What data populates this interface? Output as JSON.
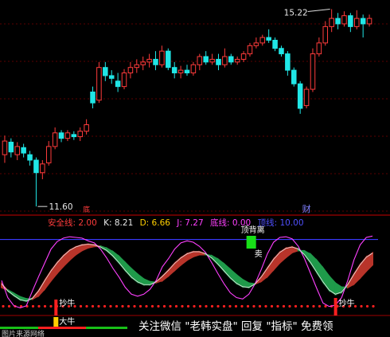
{
  "chart_data": [
    {
      "type": "candlestick",
      "title": "",
      "annotations": {
        "high_label": "15.22",
        "low_label": "11.60",
        "marker_cai": "财",
        "marker_di": "底"
      },
      "colors": {
        "up": "#ff3b3b",
        "down": "#20e6e6",
        "grid": "#7a0000"
      },
      "candles": [
        {
          "o": 12.55,
          "c": 12.8,
          "h": 12.9,
          "l": 12.4
        },
        {
          "o": 12.78,
          "c": 12.6,
          "h": 12.85,
          "l": 12.5
        },
        {
          "o": 12.55,
          "c": 12.7,
          "h": 12.78,
          "l": 12.45
        },
        {
          "o": 12.68,
          "c": 12.58,
          "h": 12.75,
          "l": 12.5
        },
        {
          "o": 12.55,
          "c": 12.45,
          "h": 12.62,
          "l": 12.35
        },
        {
          "o": 12.45,
          "c": 12.22,
          "h": 12.5,
          "l": 11.6
        },
        {
          "o": 12.22,
          "c": 12.38,
          "h": 12.45,
          "l": 12.1
        },
        {
          "o": 12.4,
          "c": 12.7,
          "h": 12.8,
          "l": 12.35
        },
        {
          "o": 12.7,
          "c": 12.95,
          "h": 13.05,
          "l": 12.65
        },
        {
          "o": 12.95,
          "c": 12.85,
          "h": 13.0,
          "l": 12.78
        },
        {
          "o": 12.85,
          "c": 12.95,
          "h": 13.0,
          "l": 12.8
        },
        {
          "o": 12.92,
          "c": 12.88,
          "h": 12.98,
          "l": 12.82
        },
        {
          "o": 12.88,
          "c": 12.98,
          "h": 13.05,
          "l": 12.8
        },
        {
          "o": 12.98,
          "c": 13.1,
          "h": 13.2,
          "l": 12.92
        },
        {
          "o": 13.7,
          "c": 13.5,
          "h": 13.8,
          "l": 13.4
        },
        {
          "o": 13.55,
          "c": 14.15,
          "h": 14.25,
          "l": 13.5
        },
        {
          "o": 14.15,
          "c": 14.0,
          "h": 14.25,
          "l": 13.9
        },
        {
          "o": 14.0,
          "c": 13.95,
          "h": 14.1,
          "l": 13.85
        },
        {
          "o": 13.9,
          "c": 13.8,
          "h": 14.05,
          "l": 13.7
        },
        {
          "o": 13.8,
          "c": 14.05,
          "h": 14.12,
          "l": 13.75
        },
        {
          "o": 14.05,
          "c": 14.15,
          "h": 14.25,
          "l": 13.95
        },
        {
          "o": 14.15,
          "c": 14.2,
          "h": 14.3,
          "l": 14.05
        },
        {
          "o": 14.2,
          "c": 14.25,
          "h": 14.35,
          "l": 14.1
        },
        {
          "o": 14.25,
          "c": 14.3,
          "h": 14.4,
          "l": 14.15
        },
        {
          "o": 14.3,
          "c": 14.2,
          "h": 14.45,
          "l": 14.1
        },
        {
          "o": 14.2,
          "c": 14.45,
          "h": 14.55,
          "l": 14.15
        },
        {
          "o": 14.45,
          "c": 14.15,
          "h": 14.5,
          "l": 14.1
        },
        {
          "o": 14.15,
          "c": 14.05,
          "h": 14.25,
          "l": 13.95
        },
        {
          "o": 14.05,
          "c": 14.1,
          "h": 14.18,
          "l": 13.95
        },
        {
          "o": 14.1,
          "c": 14.05,
          "h": 14.2,
          "l": 14.0
        },
        {
          "o": 14.05,
          "c": 14.2,
          "h": 14.25,
          "l": 14.0
        },
        {
          "o": 14.2,
          "c": 14.35,
          "h": 14.4,
          "l": 14.1
        },
        {
          "o": 14.35,
          "c": 14.25,
          "h": 14.45,
          "l": 14.2
        },
        {
          "o": 14.25,
          "c": 14.3,
          "h": 14.4,
          "l": 14.2
        },
        {
          "o": 14.3,
          "c": 14.2,
          "h": 14.4,
          "l": 14.1
        },
        {
          "o": 14.2,
          "c": 14.35,
          "h": 14.5,
          "l": 14.15
        },
        {
          "o": 14.35,
          "c": 14.25,
          "h": 14.4,
          "l": 14.2
        },
        {
          "o": 14.25,
          "c": 14.3,
          "h": 14.35,
          "l": 14.2
        },
        {
          "o": 14.3,
          "c": 14.4,
          "h": 14.45,
          "l": 14.25
        },
        {
          "o": 14.4,
          "c": 14.55,
          "h": 14.6,
          "l": 14.35
        },
        {
          "o": 14.55,
          "c": 14.6,
          "h": 14.7,
          "l": 14.5
        },
        {
          "o": 14.6,
          "c": 14.7,
          "h": 14.75,
          "l": 14.55
        },
        {
          "o": 14.7,
          "c": 14.65,
          "h": 14.85,
          "l": 14.6
        },
        {
          "o": 14.65,
          "c": 14.5,
          "h": 14.7,
          "l": 14.45
        },
        {
          "o": 14.5,
          "c": 14.4,
          "h": 14.55,
          "l": 14.35
        },
        {
          "o": 14.4,
          "c": 14.1,
          "h": 14.45,
          "l": 14.0
        },
        {
          "o": 14.1,
          "c": 13.85,
          "h": 14.15,
          "l": 13.8
        },
        {
          "o": 13.85,
          "c": 13.4,
          "h": 13.9,
          "l": 13.3
        },
        {
          "o": 13.45,
          "c": 13.75,
          "h": 13.8,
          "l": 13.4
        },
        {
          "o": 13.75,
          "c": 14.4,
          "h": 14.5,
          "l": 13.7
        },
        {
          "o": 14.4,
          "c": 14.6,
          "h": 14.7,
          "l": 14.35
        },
        {
          "o": 14.6,
          "c": 14.9,
          "h": 15.0,
          "l": 14.55
        },
        {
          "o": 14.9,
          "c": 15.05,
          "h": 15.22,
          "l": 14.8
        },
        {
          "o": 15.05,
          "c": 14.95,
          "h": 15.15,
          "l": 14.85
        },
        {
          "o": 14.95,
          "c": 15.1,
          "h": 15.18,
          "l": 14.9
        },
        {
          "o": 15.1,
          "c": 14.9,
          "h": 15.15,
          "l": 14.8
        },
        {
          "o": 14.9,
          "c": 15.05,
          "h": 15.2,
          "l": 14.85
        },
        {
          "o": 15.05,
          "c": 14.95,
          "h": 15.12,
          "l": 14.7
        },
        {
          "o": 14.95,
          "c": 15.05,
          "h": 15.12,
          "l": 14.9
        }
      ],
      "ylim": [
        11.5,
        15.3
      ]
    },
    {
      "type": "indicator",
      "header": [
        {
          "text": "安全线: 2.00",
          "color": "#ff3b3b"
        },
        {
          "text": "K: 8.21",
          "color": "#e8e8e8"
        },
        {
          "text": "D: 6.66",
          "color": "#ffd000"
        },
        {
          "text": "J: 7.27",
          "color": "#ff40ff"
        },
        {
          "text": "底线: 0.00",
          "color": "#ff40ff"
        },
        {
          "text": "顶线: 10.00",
          "color": "#5050ff"
        }
      ],
      "labels": {
        "top_signal": "顶背离",
        "sell_signal": "卖",
        "buy_signal_1": "抄牛",
        "buy_signal_2": "抄牛",
        "buy_signal_3": "大牛",
        "bottom_text": "图片来源网络"
      },
      "ylim": [
        -1,
        11
      ],
      "top_line": 10.0,
      "bottom_line": 0.0,
      "safe_line": 2.0,
      "k_series": [
        3.5,
        2.5,
        1.8,
        1.2,
        1.0,
        1.4,
        2.5,
        4.0,
        5.4,
        6.6,
        7.6,
        8.4,
        8.9,
        9.2,
        9.3,
        9.2,
        8.9,
        8.4,
        7.6,
        6.6,
        5.5,
        4.5,
        3.8,
        3.4,
        3.4,
        3.8,
        4.6,
        5.5,
        6.5,
        7.3,
        7.9,
        8.2,
        8.2,
        7.9,
        7.3,
        6.4,
        5.4,
        4.4,
        3.6,
        3.1,
        3.0,
        3.5,
        4.5,
        5.8,
        7.1,
        8.1,
        8.7,
        8.9,
        8.6,
        7.8,
        6.6,
        5.2,
        3.8,
        2.6,
        2.0,
        2.3,
        3.4,
        4.9,
        6.3,
        7.4,
        8.0
      ],
      "d_series": [
        3.0,
        2.6,
        2.1,
        1.6,
        1.3,
        1.3,
        1.8,
        2.8,
        4.0,
        5.1,
        6.1,
        7.0,
        7.8,
        8.4,
        8.8,
        9.0,
        9.0,
        8.7,
        8.2,
        7.5,
        6.6,
        5.7,
        4.9,
        4.2,
        3.8,
        3.7,
        4.0,
        4.7,
        5.5,
        6.3,
        7.0,
        7.5,
        7.8,
        7.8,
        7.6,
        7.1,
        6.4,
        5.6,
        4.8,
        4.1,
        3.6,
        3.5,
        3.9,
        4.6,
        5.6,
        6.6,
        7.4,
        8.1,
        8.4,
        8.3,
        7.8,
        6.9,
        5.8,
        4.6,
        3.6,
        3.0,
        3.0,
        3.5,
        4.4,
        5.4,
        6.3
      ],
      "j_series": [
        4.0,
        1.5,
        0.3,
        0.0,
        0.3,
        2.5,
        4.6,
        6.6,
        8.6,
        9.7,
        10.2,
        10.4,
        10.3,
        10.2,
        9.8,
        9.5,
        8.6,
        7.3,
        5.8,
        4.5,
        3.0,
        2.0,
        1.7,
        2.0,
        2.7,
        4.0,
        6.0,
        7.2,
        8.6,
        9.5,
        9.8,
        9.6,
        9.0,
        8.1,
        6.6,
        5.0,
        3.5,
        2.2,
        1.5,
        1.3,
        2.0,
        3.5,
        5.6,
        7.9,
        9.6,
        10.3,
        10.4,
        10.1,
        9.0,
        7.2,
        5.0,
        2.8,
        0.7,
        0.2,
        0.4,
        1.5,
        4.0,
        7.0,
        9.2,
        10.3,
        10.5
      ]
    }
  ],
  "watermark": [
    "关注微信",
    "\"老韩实盘\"",
    "回复",
    "\"指标\"",
    "免费领"
  ]
}
